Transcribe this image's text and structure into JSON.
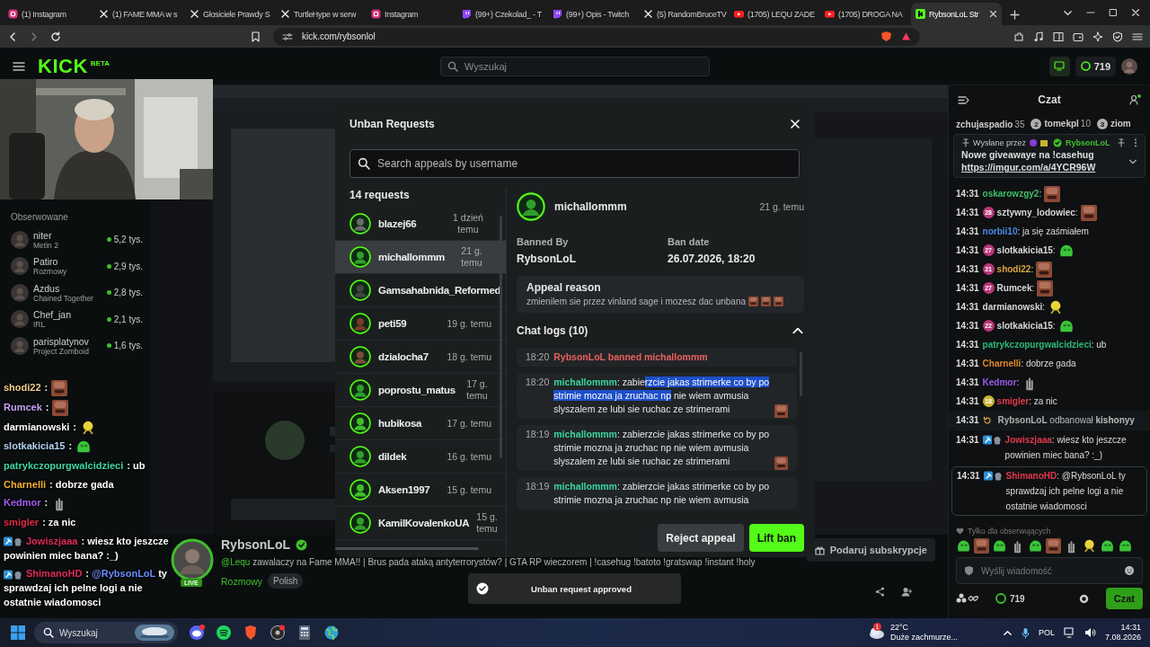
{
  "browser": {
    "tabs": [
      {
        "kind": "instagram",
        "label": "(1) Instagram",
        "selected": false
      },
      {
        "kind": "x",
        "label": "(1) FAME MMA w s",
        "selected": false
      },
      {
        "kind": "x",
        "label": "Głosiciele Prawdy S",
        "selected": false
      },
      {
        "kind": "x",
        "label": "TurtleHype w serw",
        "selected": false
      },
      {
        "kind": "instagram",
        "label": "Instagram",
        "selected": false
      },
      {
        "kind": "twitch",
        "label": "(99+) Czekolad_ - T",
        "selected": false
      },
      {
        "kind": "twitch",
        "label": "(99+) Opis - Twitch",
        "selected": false
      },
      {
        "kind": "x",
        "label": "(5) RandomBruceTV",
        "selected": false
      },
      {
        "kind": "youtube",
        "label": "(1705) LEQU ZADE",
        "selected": false
      },
      {
        "kind": "youtube",
        "label": "(1705) DROGA NA",
        "selected": false
      },
      {
        "kind": "kick",
        "label": "RybsonLoL Str",
        "selected": true
      }
    ],
    "url": "kick.com/rybsonlol"
  },
  "header": {
    "logo": "KICK",
    "logo_badge": "BETA",
    "search_placeholder": "Wyszukaj",
    "points": "719"
  },
  "sidebar": {
    "title": "Obserwowane",
    "channels": [
      {
        "name": "niter",
        "category": "Metin 2",
        "viewers": "5,2 tys."
      },
      {
        "name": "Patiro",
        "category": "Rozmowy",
        "viewers": "2,9 tys."
      },
      {
        "name": "Azdus",
        "category": "Chained Together",
        "viewers": "2,8 tys."
      },
      {
        "name": "Chef_jan",
        "category": "IRL",
        "viewers": "2,1 tys."
      },
      {
        "name": "parisplatynov",
        "category": "Project Zomboid",
        "viewers": "1,6 tys."
      }
    ]
  },
  "stream": {
    "streamer": "RybsonLoL",
    "live_badge": "LIVE",
    "title_mention": "@Lequ",
    "title": "zawalaczy na Fame MMA!! | Brus pada ataką antyterrorystów? | GTA RP wieczorem | !casehug !batoto !gratswap !instant !holy",
    "category": "Rozmowy",
    "tags": [
      "Polish"
    ],
    "gift_button": "Podaruj subskrypcje"
  },
  "chat": {
    "title": "Czat",
    "gifters": [
      {
        "name": "zchujaspadio",
        "count": "35"
      },
      {
        "rank": "2",
        "name": "tomekpl",
        "count": "10"
      },
      {
        "rank": "3",
        "name": "ziom"
      }
    ],
    "pinned": {
      "label": "Wysłane przez",
      "author": "RybsonLoL",
      "text": "Nowe giveawaye na !casehug",
      "link": "https://imgur.com/a/4YCR96W"
    },
    "messages": [
      {
        "kind": "message",
        "time": "14:31",
        "user": "oskarowzgy2",
        "color": "#3fbf6a",
        "text": ":",
        "emote": {
          "kind": "face"
        },
        "moderator": false
      },
      {
        "kind": "message",
        "time": "14:31",
        "badge": {
          "text": "28",
          "color": "#b8377a"
        },
        "user": "sztywny_lodowiec",
        "color": "#d8d8d8",
        "text": ":",
        "emote": {
          "kind": "face"
        },
        "moderator": false
      },
      {
        "kind": "message",
        "time": "14:31",
        "user": "norbii10",
        "color": "#4a8be5",
        "text": ": ja się zaśmiałem",
        "moderator": false
      },
      {
        "kind": "message",
        "time": "14:31",
        "badge": {
          "text": "27",
          "color": "#b8377a"
        },
        "user": "slotkakicia15",
        "color": "#d8d8d8",
        "text": ":",
        "emote": {
          "kind": "blob"
        },
        "moderator": false
      },
      {
        "kind": "message",
        "time": "14:31",
        "badge": {
          "text": "21",
          "color": "#b8377a"
        },
        "user": "shodi22",
        "color": "#d9a640",
        "text": ":",
        "emote": {
          "kind": "face"
        },
        "moderator": false
      },
      {
        "kind": "message",
        "time": "14:31",
        "badge": {
          "text": "27",
          "color": "#b8377a"
        },
        "user": "Rumcek",
        "color": "#d8d8d8",
        "text": ":",
        "emote": {
          "kind": "face"
        },
        "moderator": false
      },
      {
        "kind": "message",
        "time": "14:31",
        "user": "darmianowski",
        "color": "#d8d8d8",
        "text": ":",
        "emote": {
          "kind": "sponge"
        },
        "moderator": false
      },
      {
        "kind": "message",
        "time": "14:31",
        "badge": {
          "text": "22",
          "color": "#b8377a"
        },
        "user": "slotkakicia15",
        "color": "#d8d8d8",
        "text": ":",
        "emote": {
          "kind": "blob"
        },
        "moderator": false
      },
      {
        "kind": "message",
        "time": "14:31",
        "user": "patrykczopurgwalcidzieci",
        "color": "#2fb87a",
        "text": ": ub",
        "moderator": false
      },
      {
        "kind": "message",
        "time": "14:31",
        "user": "Charnelli",
        "color": "#e08a2a",
        "text": ": dobrze gada",
        "moderator": false
      },
      {
        "kind": "message",
        "time": "14:31",
        "user": "Kedmor",
        "color": "#9a5ae9",
        "text": ":",
        "emote": {
          "kind": "hand"
        },
        "moderator": false
      },
      {
        "kind": "message",
        "time": "14:31",
        "badge": {
          "text": "18",
          "color": "#c8b431"
        },
        "user": "smigler",
        "color": "#e0384c",
        "text": ": za nic",
        "moderator": false
      },
      {
        "kind": "system",
        "time": "14:31",
        "user": "RybsonLoL",
        "color": "#b0b0b0",
        "text": "odbanował **kishonyy**",
        "moderator": false
      },
      {
        "kind": "message",
        "time": "14:31",
        "user": "Jowiszjaaa",
        "color": "#e0384c",
        "text": ": wiesz kto jeszcze powinien miec bana? :_)",
        "moderator": true
      },
      {
        "kind": "highlight",
        "time": "14:31",
        "user": "ShimanoHD",
        "color": "#e0384c",
        "text": ": @RybsonLoL ty sprawdzaj ich pelne logi a nie ostatnie wiadomosci",
        "moderator": true
      }
    ],
    "followers_only": "Tylko dla obserwujących",
    "emote_bar": [
      {
        "kind": "blob"
      },
      {
        "kind": "face"
      },
      {
        "kind": "blob"
      },
      {
        "kind": "hand"
      },
      {
        "kind": "blob"
      },
      {
        "kind": "face"
      },
      {
        "kind": "hand"
      },
      {
        "kind": "sponge"
      },
      {
        "kind": "blob"
      },
      {
        "kind": "blob"
      }
    ],
    "input_placeholder": "Wyślij wiadomość",
    "points": "719",
    "send_button": "Czat"
  },
  "overlay_chat": {
    "messages": [
      {
        "user": "shodi22",
        "color": "#f3cf8e",
        "text": ":",
        "emote": {
          "kind": "face"
        },
        "moderator": false
      },
      {
        "user": "Rumcek",
        "color": "#c7a2f2",
        "text": ":",
        "emote": {
          "kind": "face"
        },
        "moderator": false
      },
      {
        "user": "darmianowski",
        "color": "#ffffff",
        "text": ":",
        "emote": {
          "kind": "sponge"
        },
        "moderator": false
      },
      {
        "user": "slotkakicia15",
        "color": "#b4d2f2",
        "text": ":",
        "emote": {
          "kind": "blob"
        },
        "moderator": false
      },
      {
        "user": "patrykczopurgwalcidzieci",
        "color": "#3fd6a6",
        "text": ": ub",
        "moderator": false
      },
      {
        "user": "Charnelli",
        "color": "#f2b232",
        "text": ": dobrze gada",
        "moderator": false
      },
      {
        "user": "Kedmor",
        "color": "#a25cf2",
        "text": ":",
        "emote": {
          "kind": "hand"
        },
        "moderator": false
      },
      {
        "user": "smigler",
        "color": "#e02c44",
        "text": ": za nic",
        "moderator": false
      },
      {
        "user": "Jowiszjaaa",
        "color": "#e02c5c",
        "text": ": wiesz kto jeszcze powinien miec bana? :_)",
        "moderator": true
      },
      {
        "user": "ShimanoHD",
        "color": "#e02c5c",
        "text": ":",
        "mention": "@RybsonLoL",
        "rest": "ty sprawdzaj ich pelne logi a nie ostatnie wiadomosci",
        "moderator": true
      }
    ]
  },
  "modal": {
    "title": "Unban Requests",
    "search_placeholder": "Search appeals by username",
    "count": "14 requests",
    "requests": [
      {
        "user": "blazej66",
        "time": "1 dzień temu",
        "selected": false
      },
      {
        "user": "michallommm",
        "time": "21 g. temu",
        "selected": true
      },
      {
        "user": "Gamsahabnida_Reformed",
        "selected": false
      },
      {
        "user": "peti59",
        "time": "19 g. temu",
        "selected": false
      },
      {
        "user": "dzialocha7",
        "time": "18 g. temu",
        "selected": false
      },
      {
        "user": "poprostu_matus",
        "time": "17 g. temu",
        "selected": false
      },
      {
        "user": "hubikosa",
        "time": "17 g. temu",
        "selected": false
      },
      {
        "user": "dildek",
        "time": "16 g. temu",
        "selected": false
      },
      {
        "user": "Aksen1997",
        "time": "15 g. temu",
        "selected": false
      },
      {
        "user": "KamilKovalenkoUA",
        "time": "15 g. temu",
        "selected": false
      }
    ],
    "detail": {
      "user": "michallommm",
      "time": "21 g. temu",
      "banned_by_label": "Banned By",
      "banned_by": "RybsonLoL",
      "ban_date_label": "Ban date",
      "ban_date": "26.07.2026, 18:20",
      "appeal_label": "Appeal reason",
      "appeal_text": "zmienilem sie przez vinland sage i mozesz dac unbana",
      "appeal_emotes": [
        {
          "kind": "face"
        },
        {
          "kind": "face"
        },
        {
          "kind": "face"
        }
      ],
      "logs_title": "Chat logs (10)",
      "logs_expanded": true,
      "logs": [
        {
          "kind": "ban",
          "time": "18:20",
          "text": "RybsonLoL banned michallommm"
        },
        {
          "kind": "message",
          "time": "18:20",
          "user": "michallommm",
          "parts": [
            {
              "text": ": zabie",
              "selected": false
            },
            {
              "text": "rzcie jakas strimerke co by po strimie mozna ja zruchac np",
              "selected": true
            },
            {
              "text": " nie wiem avmusia slyszalem ze lubi sie ruchac ze strimerami",
              "selected": false
            }
          ],
          "emote": {
            "kind": "face"
          }
        },
        {
          "kind": "message",
          "time": "18:19",
          "user": "michallommm",
          "parts": [
            {
              "text": ": zabierzcie jakas strimerke co by po strimie mozna ja zruchac np nie wiem avmusia slyszalem ze lubi sie ruchac ze strimerami",
              "selected": false
            }
          ],
          "emote": {
            "kind": "face"
          }
        },
        {
          "kind": "message",
          "time": "18:19",
          "user": "michallommm",
          "parts": [
            {
              "text": ": zabierzcie jakas strimerke co by po strimie mozna ja zruchac np nie wiem avmusia",
              "selected": false
            }
          ]
        }
      ]
    },
    "reject_button": "Reject appeal",
    "lift_button": "Lift ban"
  },
  "toast": {
    "text": "Unban request approved"
  },
  "taskbar": {
    "search_placeholder": "Wyszukaj",
    "weather_badge": "1",
    "temperature": "22°C",
    "weather": "Duże zachmurze...",
    "language": "POL",
    "time": "14:31",
    "date": "7.08.2026"
  }
}
